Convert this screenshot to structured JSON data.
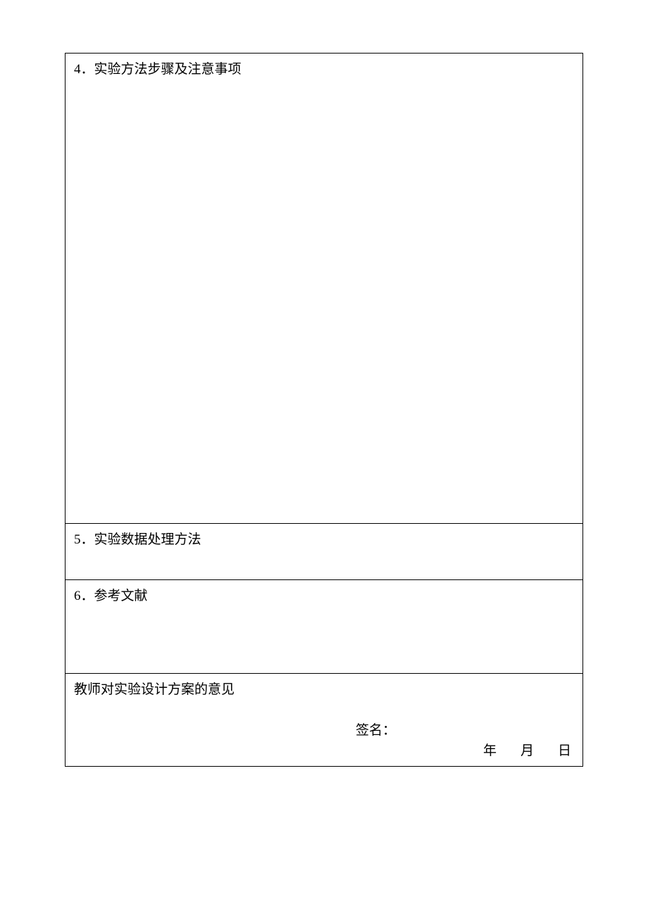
{
  "sections": {
    "s4": "4．实验方法步骤及注意事项",
    "s5": "5．实验数据处理方法",
    "s6": "6．参考文献",
    "teacher": "教师对实验设计方案的意见"
  },
  "signature": {
    "label": "签名：",
    "year": "年",
    "month": "月",
    "day": "日"
  }
}
